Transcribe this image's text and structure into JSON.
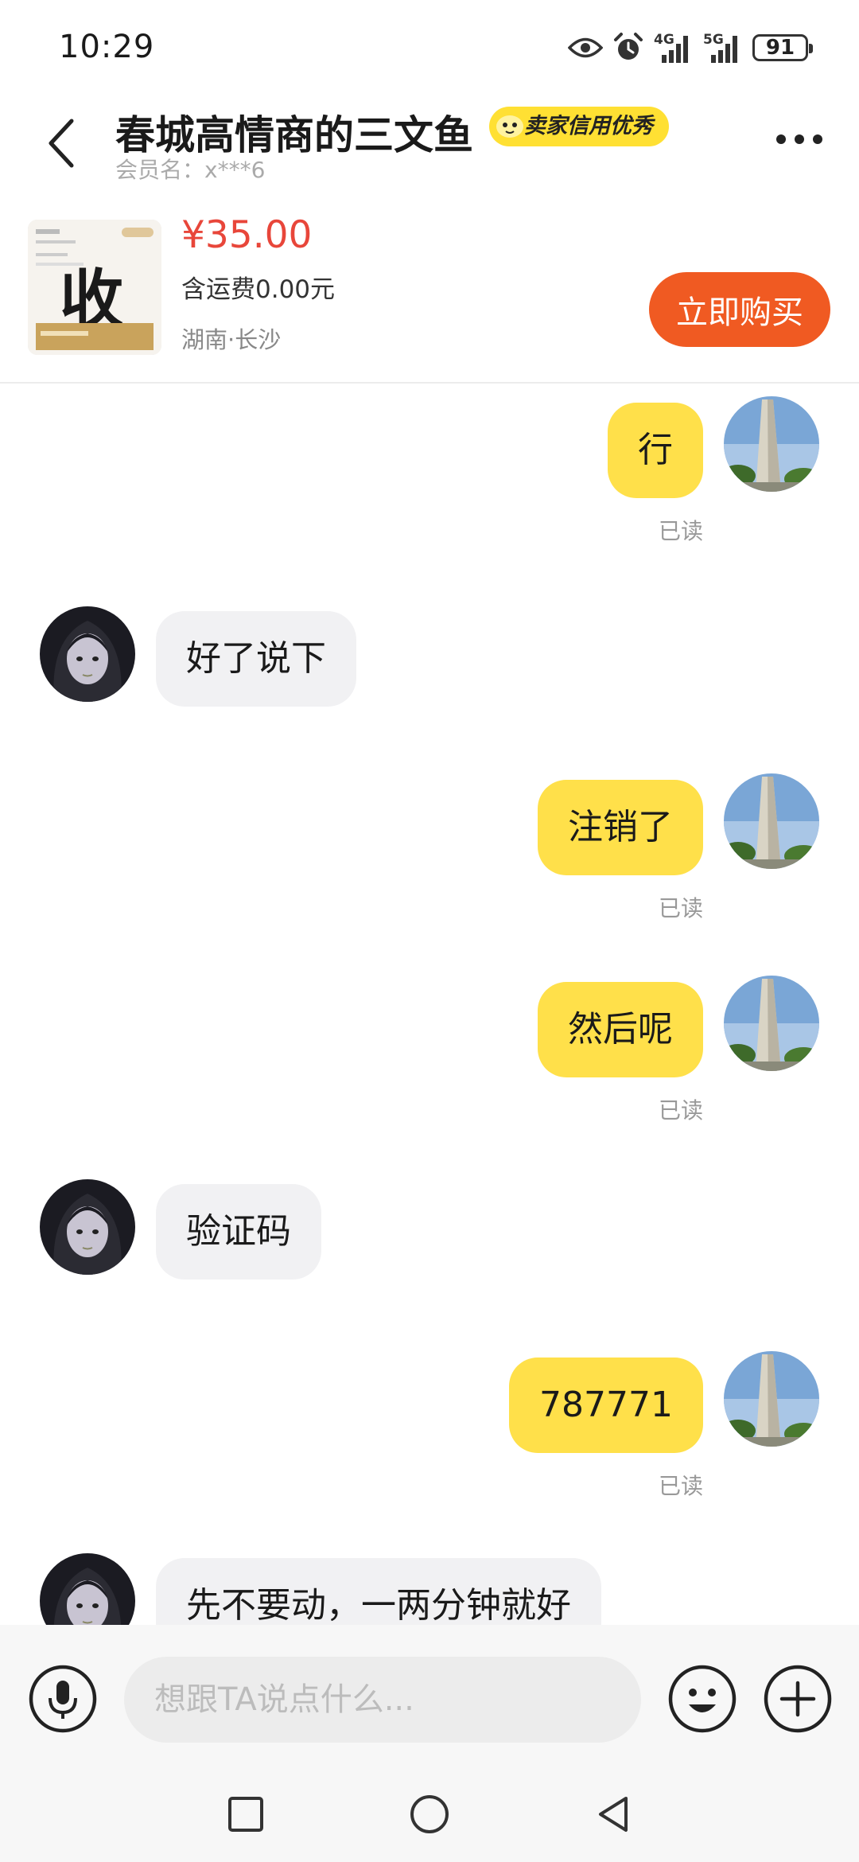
{
  "status_bar": {
    "time": "10:29",
    "battery": "91",
    "network": [
      "4G",
      "5G"
    ],
    "icons": [
      "eye-icon",
      "alarm-icon",
      "signal-4g-icon",
      "signal-5g-icon",
      "battery-icon"
    ]
  },
  "header": {
    "title": "春城高情商的三文鱼",
    "badge": "卖家信用优秀",
    "member": "会员名：x***6"
  },
  "product": {
    "price": "¥35.00",
    "shipping": "含运费0.00元",
    "location": "湖南·长沙",
    "buy_label": "立即购买",
    "thumb_char": "收"
  },
  "messages": [
    {
      "side": "self",
      "text": "行",
      "status": "已读"
    },
    {
      "side": "other",
      "text": "好了说下"
    },
    {
      "side": "self",
      "text": "注销了",
      "status": "已读"
    },
    {
      "side": "self",
      "text": "然后呢",
      "status": "已读"
    },
    {
      "side": "other",
      "text": "验证码"
    },
    {
      "side": "self",
      "text": "787771",
      "status": "已读"
    },
    {
      "side": "other",
      "text": "先不要动，一两分钟就好"
    }
  ],
  "input": {
    "placeholder": "想跟TA说点什么..."
  },
  "colors": {
    "accent_yellow": "#ffe04a",
    "buy_orange": "#f05a22",
    "price_red": "#e8463a"
  }
}
